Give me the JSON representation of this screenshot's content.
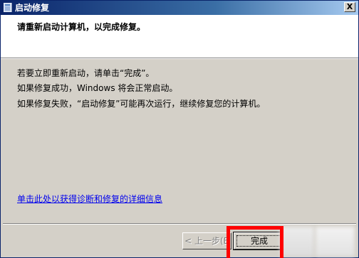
{
  "window": {
    "title": "启动修复",
    "close_glyph": "X"
  },
  "header": {
    "text": "请重新启动计算机，以完成修复。"
  },
  "body": {
    "line1": "若要立即重新启动，请单击“完成”。",
    "line2": "如果修复成功，Windows 将会正常启动。",
    "line3": "如果修复失败，“启动修复”可能再次运行，继续修复您的计算机。"
  },
  "details_link": "单击此处以获得诊断和修复的详细信息",
  "buttons": {
    "back_label": "< 上一步(B",
    "finish_label": "完成"
  },
  "colors": {
    "titlebar_start": "#0a246a",
    "link": "#0000ee",
    "annotation_red": "#ff0000"
  },
  "icons": {
    "title_icon": "app-window-icon"
  }
}
